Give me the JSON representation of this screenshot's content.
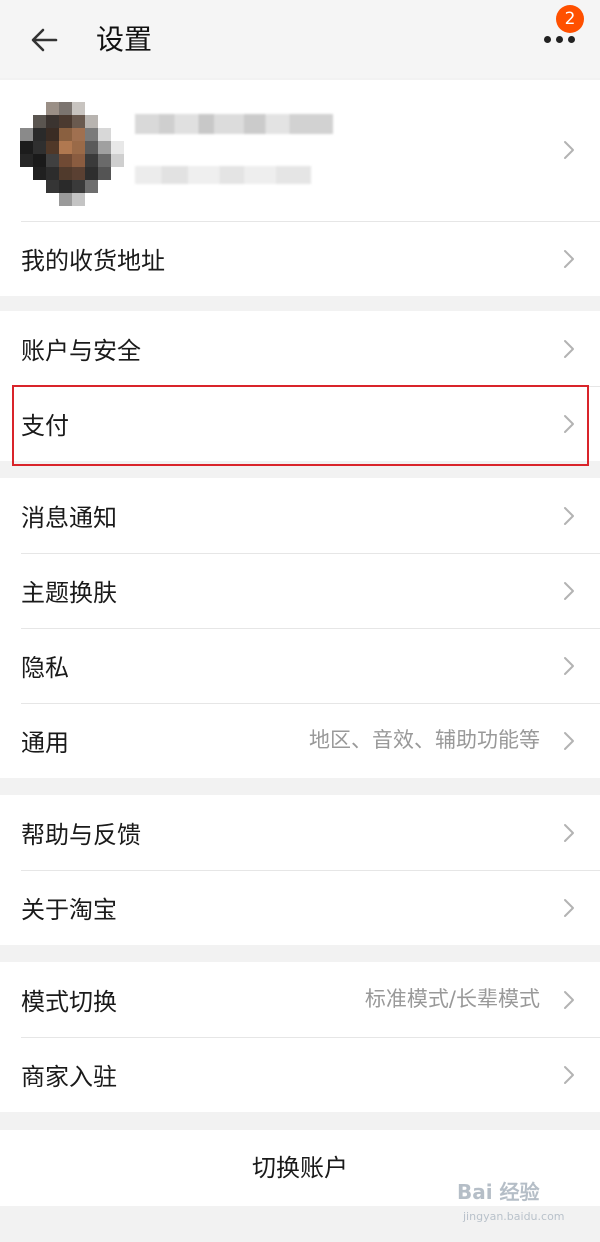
{
  "header": {
    "title": "设置",
    "badge_count": "2"
  },
  "profile": {
    "name": "",
    "subtitle": ""
  },
  "groups": [
    {
      "items": [
        {
          "label": "我的收货地址",
          "hint": ""
        }
      ]
    },
    {
      "items": [
        {
          "label": "账户与安全",
          "hint": ""
        },
        {
          "label": "支付",
          "hint": ""
        }
      ]
    },
    {
      "items": [
        {
          "label": "消息通知",
          "hint": ""
        },
        {
          "label": "主题换肤",
          "hint": ""
        },
        {
          "label": "隐私",
          "hint": ""
        },
        {
          "label": "通用",
          "hint": "地区、音效、辅助功能等"
        }
      ]
    },
    {
      "items": [
        {
          "label": "帮助与反馈",
          "hint": ""
        },
        {
          "label": "关于淘宝",
          "hint": ""
        }
      ]
    },
    {
      "items": [
        {
          "label": "模式切换",
          "hint": "标准模式/长辈模式"
        },
        {
          "label": "商家入驻",
          "hint": ""
        }
      ]
    }
  ],
  "switch_account": {
    "label": "切换账户"
  },
  "watermark": {
    "text": "Bai 经验",
    "sub": "jingyan.baidu.com"
  },
  "colors": {
    "badge": "#ff5000",
    "highlight": "#d9242a",
    "background": "#f2f2f2"
  },
  "icons": {
    "back": "arrow-left-icon",
    "more": "more-dots-icon",
    "chevron": "chevron-right-icon"
  }
}
